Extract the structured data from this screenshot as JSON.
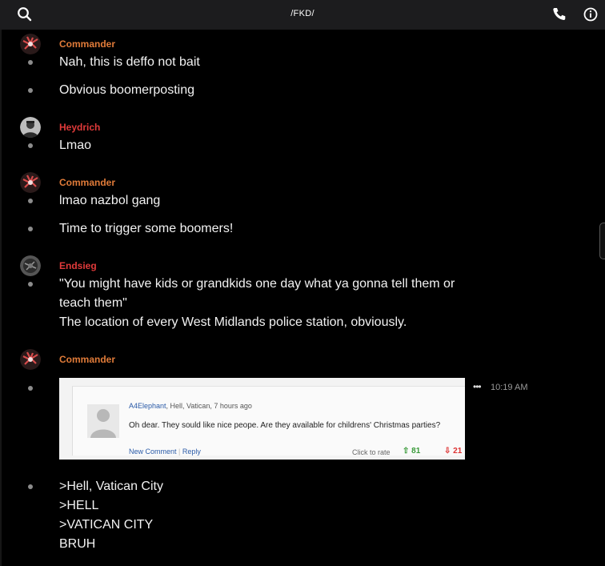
{
  "header": {
    "title": "/FKD/",
    "search_icon": "search-icon",
    "call_icon": "phone-icon",
    "info_icon": "info-icon"
  },
  "colors": {
    "commander": "#e07b39",
    "heydrich": "#e03a3a",
    "endsieg": "#e03a3a"
  },
  "messages": [
    {
      "author": "Commander",
      "lines": [
        "Nah, this is deffo not bait",
        "Obvious boomerposting"
      ]
    },
    {
      "author": "Heydrich",
      "lines": [
        "Lmao"
      ]
    },
    {
      "author": "Commander",
      "lines": [
        "lmao nazbol gang",
        "Time to trigger some boomers!"
      ]
    },
    {
      "author": "Endsieg",
      "lines": [
        "\"You might have kids or grandkids one day what ya gonna tell them or teach them\"\nThe location of every West Midlands police station, obviously."
      ]
    },
    {
      "author": "Commander",
      "lines": [
        ">Hell, Vatican City\n>HELL\n>VATICAN CITY\nBRUH"
      ]
    }
  ],
  "embed": {
    "author": "A4Elephant",
    "meta": ", Hell, Vatican, 7 hours ago",
    "body": "Oh dear. They sould like nice peope. Are they available for childrens' Christmas parties?",
    "new_comment": "New Comment",
    "reply": "Reply",
    "click_to_rate": "Click to rate",
    "upvotes": "81",
    "downvotes": "21"
  },
  "embed_time": "10:19 AM",
  "more_label": "•••"
}
